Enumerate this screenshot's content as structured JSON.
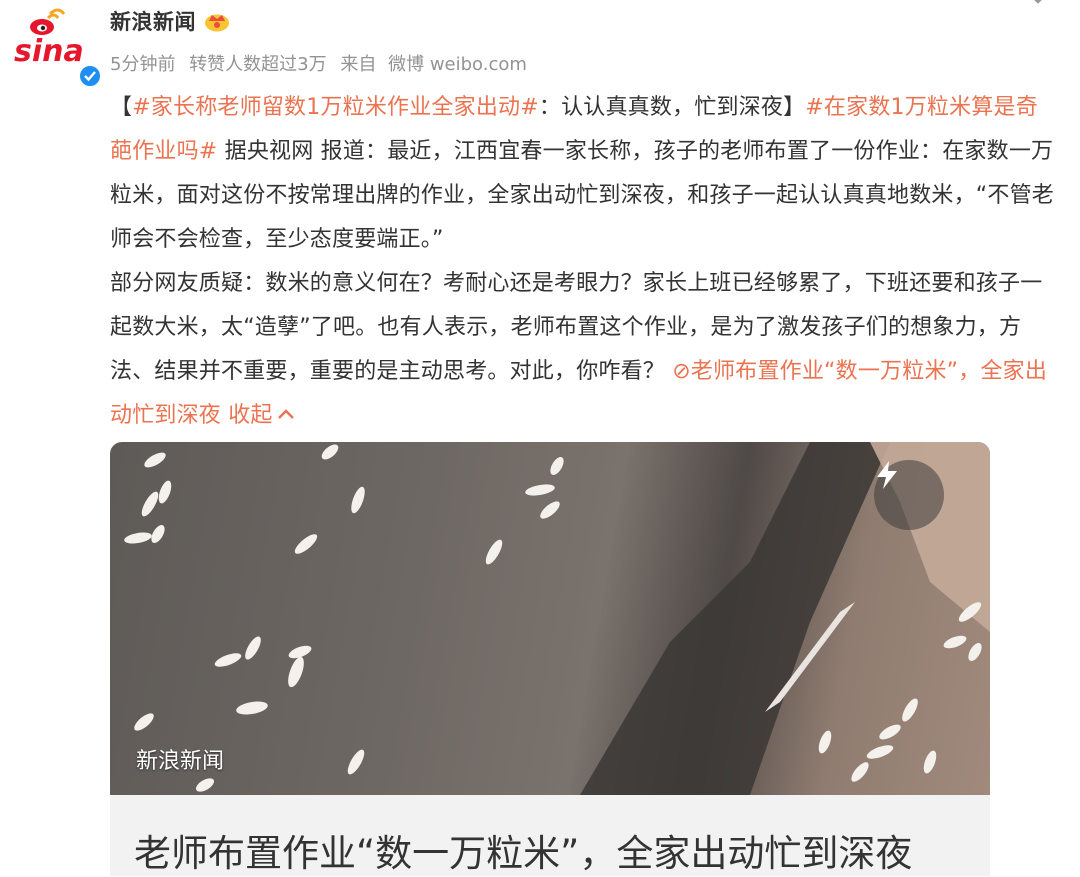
{
  "post": {
    "author": "新浪新闻",
    "time": "5分钟前",
    "reposts": "转赞人数超过3万",
    "source_prefix": "来自",
    "source": "微博 weibo.com",
    "bracket_open": "【",
    "topic1": "#家长称老师留数1万粒米作业全家出动#",
    "headline": "：认认真真数，忙到深夜】",
    "topic2": "#在家数1万粒米算是奇葩作业吗#",
    "body1": " 据央视网 报道：最近，江西宜春一家长称，孩子的老师布置了一份作业：在家数一万粒米，面对这份不按常理出牌的作业，全家出动忙到深夜，和孩子一起认认真真地数米，“不管老师会不会检查，至少态度要端正。”",
    "body2": "部分网友质疑：数米的意义何在？考耐心还是考眼力？家长上班已经够累了，下班还要和孩子一起数大米，太“造孽”了吧。也有人表示，老师布置这个作业，是为了激发孩子们的想象力，方法、结果并不重要，重要的是主动思考。对此，你咋看？ ",
    "link_icon": "⊘",
    "link_text": "老师布置作业“数一万粒米”，全家出动忙到深夜",
    "collapse": " 收起",
    "collapse_icon": "chevron-up-icon"
  },
  "media": {
    "watermark": "新浪新闻",
    "card_title": "老师布置作业“数一万粒米”，全家出动忙到深夜",
    "play_icon": "lightning-icon"
  },
  "colors": {
    "link": "#eb7350",
    "text": "#333333",
    "meta": "#939393",
    "verified": "#1f8ef1"
  }
}
